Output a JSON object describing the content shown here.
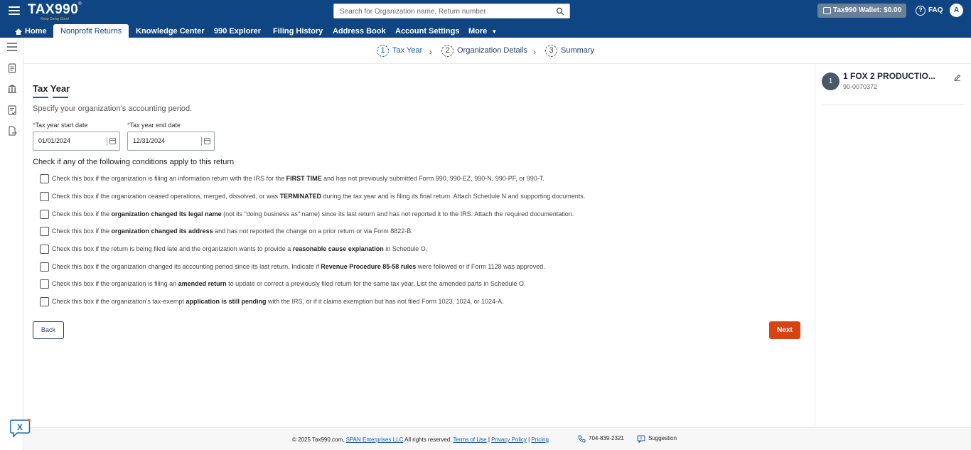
{
  "header": {
    "logo": "TAX990",
    "logo_tagline": "Keep Doing Good",
    "search_placeholder": "Search for Organization name, Return number",
    "wallet": "Tax990 Wallet: $0.00",
    "faq": "FAQ",
    "avatar": "A"
  },
  "nav": {
    "home": "Home",
    "nonprofit_returns": "Nonprofit Returns",
    "knowledge_center": "Knowledge Center",
    "explorer": "990 Explorer",
    "filing_history": "Filing History",
    "address_book": "Address Book",
    "account_settings": "Account Settings",
    "more": "More"
  },
  "stepper": [
    {
      "num": "1",
      "label": "Tax Year"
    },
    {
      "num": "2",
      "label": "Organization Details"
    },
    {
      "num": "3",
      "label": "Summary"
    }
  ],
  "form": {
    "title": "Tax Year",
    "subtitle": "Specify your organization’s accounting period.",
    "start_label": "Tax year start date",
    "start_value": "01/01/2024",
    "end_label": "Tax year end date",
    "end_value": "12/31/2024",
    "conditions_heading": "Check if any of the following conditions apply to this return",
    "conditions": [
      {
        "pre": "Check this box if the organization is filing an information return with the IRS for the ",
        "bold": "FIRST TIME",
        "post": " and has not previously submitted Form 990, 990-EZ, 990-N, 990-PF, or 990-T."
      },
      {
        "pre": "Check this box if the organization ceased operations, merged, dissolved, or was ",
        "bold": "TERMINATED",
        "post": " during the tax year and is filing its final return. Attach Schedule N and supporting documents."
      },
      {
        "pre": "Check this box if the ",
        "bold": "organization changed its legal name",
        "post": " (not its \"doing business as\" name) since its last return and has not reported it to the IRS. Attach the required documentation."
      },
      {
        "pre": "Check this box if the ",
        "bold": "organization changed its address",
        "post": " and has not reported the change on a prior return or via Form 8822-B."
      },
      {
        "pre": "Check this box if the return is being filed late and the organization wants to provide a ",
        "bold": "reasonable cause explanation",
        "post": " in Schedule O."
      },
      {
        "pre": "Check this box if the organization changed its accounting period since its last return. Indicate if ",
        "bold": "Revenue Procedure 85-58 rules",
        "post": " were followed or if Form 1128 was approved."
      },
      {
        "pre": "Check this box if the organization is filing an ",
        "bold": "amended return",
        "post": " to update or correct a previously filed return for the same tax year. List the amended parts in Schedule O."
      },
      {
        "pre": "Check this box if the organization’s tax-exempt ",
        "bold": "application is still pending",
        "post": " with the IRS, or if it claims exemption but has not filed Form 1023, 1024, or 1024-A."
      }
    ],
    "back": "Back",
    "next": "Next"
  },
  "org": {
    "num": "1",
    "name": "1 FOX 2 PRODUCTIO...",
    "ein": "90-0070372"
  },
  "footer": {
    "copyright": "© 2025 Tax990.com,",
    "span": "SPAN Enterprises LLC",
    "rights": "All rights reserved.",
    "terms": "Terms of Use",
    "privacy": "Privacy Policy",
    "pricing": "Pricing",
    "phone": "704-839-2321",
    "suggestion": "Suggestion"
  },
  "colors": {
    "brand_blue": "#0f4583",
    "accent_orange": "#d84313"
  }
}
